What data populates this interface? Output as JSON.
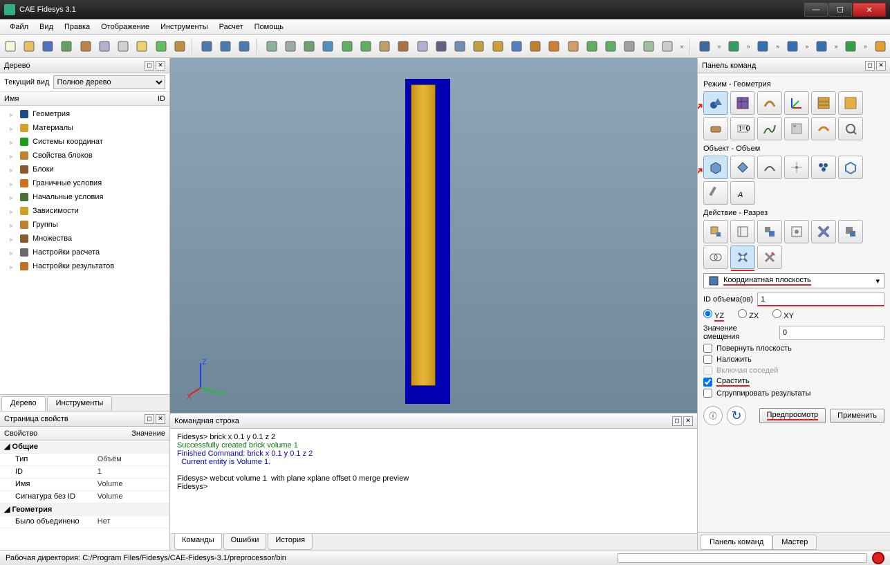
{
  "title": "CAE Fidesys 3.1",
  "menu": [
    "Файл",
    "Вид",
    "Правка",
    "Отображение",
    "Инструменты",
    "Расчет",
    "Помощь"
  ],
  "tree": {
    "panel_title": "Дерево",
    "view_label": "Текущий вид",
    "view_value": "Полное дерево",
    "col1": "Имя",
    "col2": "ID",
    "items": [
      {
        "icon": "geom",
        "label": "Геометрия",
        "color": "#1e4a8a"
      },
      {
        "icon": "mat",
        "label": "Материалы",
        "color": "#d9a02c"
      },
      {
        "icon": "coord",
        "label": "Системы координат",
        "color": "#18a018"
      },
      {
        "icon": "bprop",
        "label": "Свойства блоков",
        "color": "#c08030"
      },
      {
        "icon": "block",
        "label": "Блоки",
        "color": "#8a5a2a"
      },
      {
        "icon": "bc",
        "label": "Граничные условия",
        "color": "#d0701a"
      },
      {
        "icon": "ic",
        "label": "Начальные условия",
        "color": "#487030"
      },
      {
        "icon": "dep",
        "label": "Зависимости",
        "color": "#d0a020"
      },
      {
        "icon": "grp",
        "label": "Группы",
        "color": "#c08030"
      },
      {
        "icon": "set",
        "label": "Множества",
        "color": "#8a5a2a"
      },
      {
        "icon": "calc",
        "label": "Настройки расчета",
        "color": "#6a6a6a"
      },
      {
        "icon": "res",
        "label": "Настройки результатов",
        "color": "#c07020"
      }
    ],
    "tabs": [
      "Дерево",
      "Инструменты"
    ]
  },
  "props": {
    "panel_title": "Страница свойств",
    "col1": "Свойство",
    "col2": "Значение",
    "groups": [
      {
        "name": "Общие",
        "rows": [
          {
            "k": "Тип",
            "v": "Объём"
          },
          {
            "k": "ID",
            "v": "1"
          },
          {
            "k": "Имя",
            "v": "Volume"
          },
          {
            "k": "Сигнатура без ID",
            "v": "Volume"
          }
        ]
      },
      {
        "name": "Геометрия",
        "rows": [
          {
            "k": "Было объединено",
            "v": "Нет"
          }
        ]
      }
    ]
  },
  "console": {
    "panel_title": "Командная строка",
    "lines": [
      {
        "cls": "",
        "t": "Fidesys> brick x 0.1 y 0.1 z 2"
      },
      {
        "cls": "g",
        "t": "Successfully created brick volume 1"
      },
      {
        "cls": "b",
        "t": "Finished Command: brick x 0.1 y 0.1 z 2"
      },
      {
        "cls": "b",
        "t": "  Current entity is Volume 1."
      },
      {
        "cls": "",
        "t": ""
      },
      {
        "cls": "",
        "t": "Fidesys> webcut volume 1  with plane xplane offset 0 merge preview"
      },
      {
        "cls": "",
        "t": "Fidesys>"
      }
    ],
    "tabs": [
      "Команды",
      "Ошибки",
      "История"
    ]
  },
  "palette": {
    "panel_title": "Панель команд",
    "mode_label": "Режим - Геометрия",
    "object_label": "Объект - Объем",
    "action_label": "Действие - Разрез",
    "combo_value": "Координатная плоскость",
    "id_label": "ID объема(ов)",
    "id_value": "1",
    "radios": [
      "YZ",
      "ZX",
      "XY"
    ],
    "radio_sel": 0,
    "offset_label": "Значение смещения",
    "offset_value": "0",
    "checks": [
      {
        "label": "Повернуть плоскость",
        "checked": false,
        "dis": false
      },
      {
        "label": "Наложить",
        "checked": false,
        "dis": false
      },
      {
        "label": "Включая соседей",
        "checked": false,
        "dis": true
      },
      {
        "label": "Срастить",
        "checked": true,
        "dis": false,
        "red": true
      },
      {
        "label": "Сгруппировать результаты",
        "checked": false,
        "dis": false
      }
    ],
    "buttons": {
      "preview": "Предпросмотр",
      "apply": "Применить"
    },
    "tabs": [
      "Панель команд",
      "Мастер"
    ]
  },
  "status": {
    "text": "Рабочая директория: C:/Program Files/Fidesys/CAE-Fidesys-3.1/preprocessor/bin"
  }
}
